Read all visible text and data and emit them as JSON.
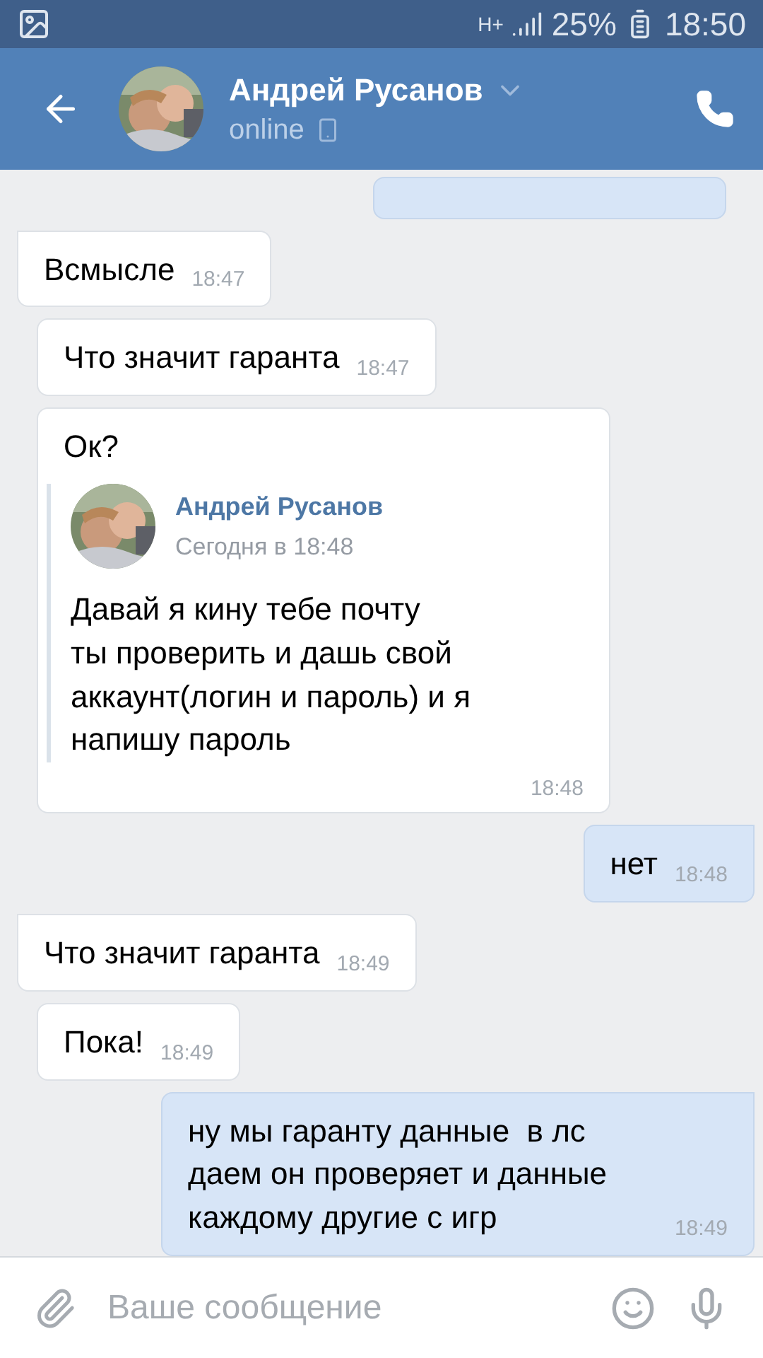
{
  "status_bar": {
    "network": "H+",
    "battery": "25%",
    "time": "18:50"
  },
  "header": {
    "name": "Андрей Русанов",
    "status": "online"
  },
  "messages": [
    {
      "kind": "clipped",
      "outgoing": true,
      "tail": false
    },
    {
      "kind": "text",
      "outgoing": false,
      "tail": true,
      "text": "Всмысле",
      "time": "18:47"
    },
    {
      "kind": "text",
      "outgoing": false,
      "tail": false,
      "text": "Что значит гаранта",
      "time": "18:47"
    },
    {
      "kind": "forward",
      "outgoing": false,
      "tail": false,
      "text": "Ок?",
      "time": "18:48",
      "forward": {
        "name": "Андрей Русанов",
        "date": "Сегодня в 18:48",
        "text": "Давай я кину тебе почту\nты проверить и дашь свой\nаккаунт(логин и пароль) и я\nнапишу пароль"
      }
    },
    {
      "kind": "text",
      "outgoing": true,
      "tail": true,
      "text": "нет",
      "time": "18:48"
    },
    {
      "kind": "text",
      "outgoing": false,
      "tail": true,
      "text": "Что значит гаранта",
      "time": "18:49"
    },
    {
      "kind": "text",
      "outgoing": false,
      "tail": false,
      "text": "Пока!",
      "time": "18:49"
    },
    {
      "kind": "text",
      "outgoing": true,
      "tail": true,
      "text": "ну мы гаранту данные  в лс даем он проверяет и данные каждому другие с игр",
      "time": "18:49"
    }
  ],
  "composer": {
    "placeholder": "Ваше сообщение"
  }
}
